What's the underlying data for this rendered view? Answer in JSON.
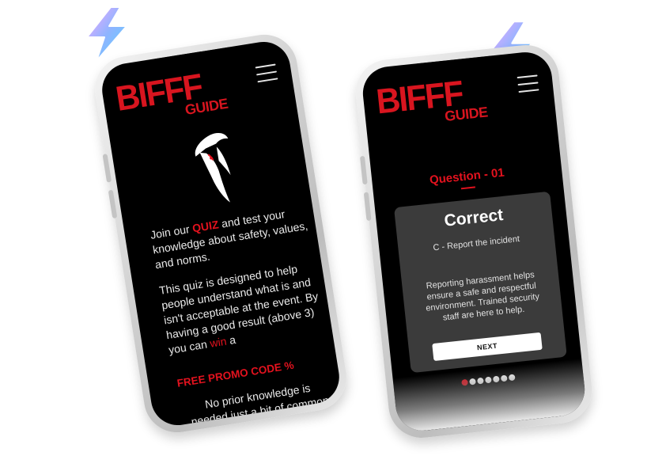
{
  "brand": {
    "logo_main": "BIFFF",
    "logo_sub": "GUIDE"
  },
  "intro": {
    "line_prefix": "Join our ",
    "quiz_word": "QUIZ",
    "line_suffix": " and test your knowledge about safety, values, and norms.",
    "para2_prefix": "This quiz is designed to help people understand what is and isn't acceptable at the event. By having a good result (above 3) you can ",
    "win_word": "win",
    "para2_suffix": " a",
    "promo": "FREE PROMO CODE %",
    "note": "No prior knowledge is needed just a bit of common sense!"
  },
  "quiz": {
    "question_title": "Question - 01",
    "result_title": "Correct",
    "answer": "C - Report the incident",
    "explanation": "Reporting harassment helps ensure a safe and respectful environment. Trained security staff are here to help.",
    "next_label": "NEXT",
    "progress": {
      "current": 1,
      "total": 7
    }
  },
  "icons": {
    "menu": "hamburger-menu-icon",
    "mascot": "hat-figure-mascot-icon",
    "bolt": "lightning-bolt-icon"
  },
  "colors": {
    "accent": "#e3121e",
    "screen_bg": "#000000",
    "card_bg": "#3b3b3b"
  }
}
